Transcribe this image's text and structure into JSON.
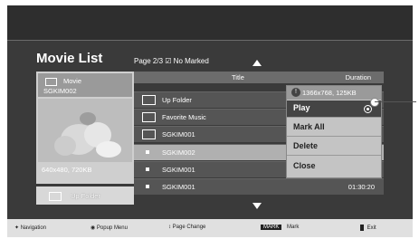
{
  "header": {
    "title": "Movie List",
    "page_info": "Page 2/3",
    "marked_label": "No Marked"
  },
  "preview": {
    "category": "Movie",
    "filename": "SGKIM002",
    "resolution": "640x480, 720KB"
  },
  "up_folder_button": {
    "label": "Up Folder"
  },
  "list": {
    "columns": {
      "title": "Title",
      "duration": "Duration"
    },
    "rows": [
      {
        "name": "Up Folder",
        "type": "folder",
        "duration": ""
      },
      {
        "name": "Favorite Music",
        "type": "folder",
        "duration": ""
      },
      {
        "name": "SGKIM001",
        "type": "folder",
        "duration": ""
      },
      {
        "name": "SGKIM002",
        "type": "file",
        "duration": "",
        "selected": true
      },
      {
        "name": "SGKIM001",
        "type": "file",
        "duration": ""
      },
      {
        "name": "SGKIM001",
        "type": "file",
        "duration": "01:30:20"
      }
    ]
  },
  "popup": {
    "info": "1366x768, 125KB",
    "items": [
      "Play",
      "Mark All",
      "Delete",
      "Close"
    ]
  },
  "footer": {
    "navigation": "Navigation",
    "popup_menu": "Popup Menu",
    "page_change": "Page Change",
    "mark_badge": "MARK",
    "mark_label": "Mark",
    "exit": "Exit"
  }
}
